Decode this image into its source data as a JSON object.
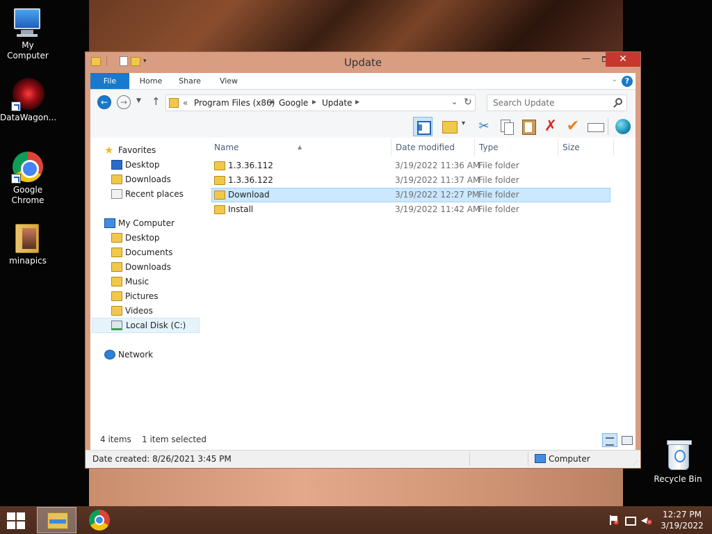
{
  "desktop": {
    "icons": [
      {
        "label": "My Computer"
      },
      {
        "label": "DataWagon..."
      },
      {
        "label": "Google Chrome"
      },
      {
        "label": "minapics"
      },
      {
        "label": "Recycle Bin"
      }
    ]
  },
  "window": {
    "title": "Update",
    "close_glyph": "✕",
    "minimize_glyph": "—"
  },
  "ribbon": {
    "tabs": [
      "File",
      "Home",
      "Share",
      "View"
    ]
  },
  "address": {
    "overflow": "«",
    "segments": [
      "Program Files (x86)",
      "Google",
      "Update"
    ]
  },
  "search": {
    "placeholder": "Search Update"
  },
  "nav_pane": {
    "favorites_header": "Favorites",
    "favorites": [
      "Desktop",
      "Downloads",
      "Recent places"
    ],
    "computer_header": "My Computer",
    "computer": [
      "Desktop",
      "Documents",
      "Downloads",
      "Music",
      "Pictures",
      "Videos",
      "Local Disk (C:)"
    ],
    "network": "Network"
  },
  "columns": {
    "name": "Name",
    "date": "Date modified",
    "type": "Type",
    "size": "Size"
  },
  "files": [
    {
      "name": "1.3.36.112",
      "date": "3/19/2022 11:36 AM",
      "type": "File folder"
    },
    {
      "name": "1.3.36.122",
      "date": "3/19/2022 11:37 AM",
      "type": "File folder"
    },
    {
      "name": "Download",
      "date": "3/19/2022 12:27 PM",
      "type": "File folder"
    },
    {
      "name": "Install",
      "date": "3/19/2022 11:42 AM",
      "type": "File folder"
    }
  ],
  "status": {
    "count": "4 items",
    "selection": "1 item selected"
  },
  "details_bar": {
    "date_created": "Date created: 8/26/2021 3:45 PM",
    "location": "Computer"
  },
  "taskbar": {
    "time": "12:27 PM",
    "date": "3/19/2022"
  },
  "colors": {
    "accent": "#1979ca",
    "selection": "#cce8ff",
    "window_frame": "#d99d82",
    "close_button": "#c7372f"
  }
}
